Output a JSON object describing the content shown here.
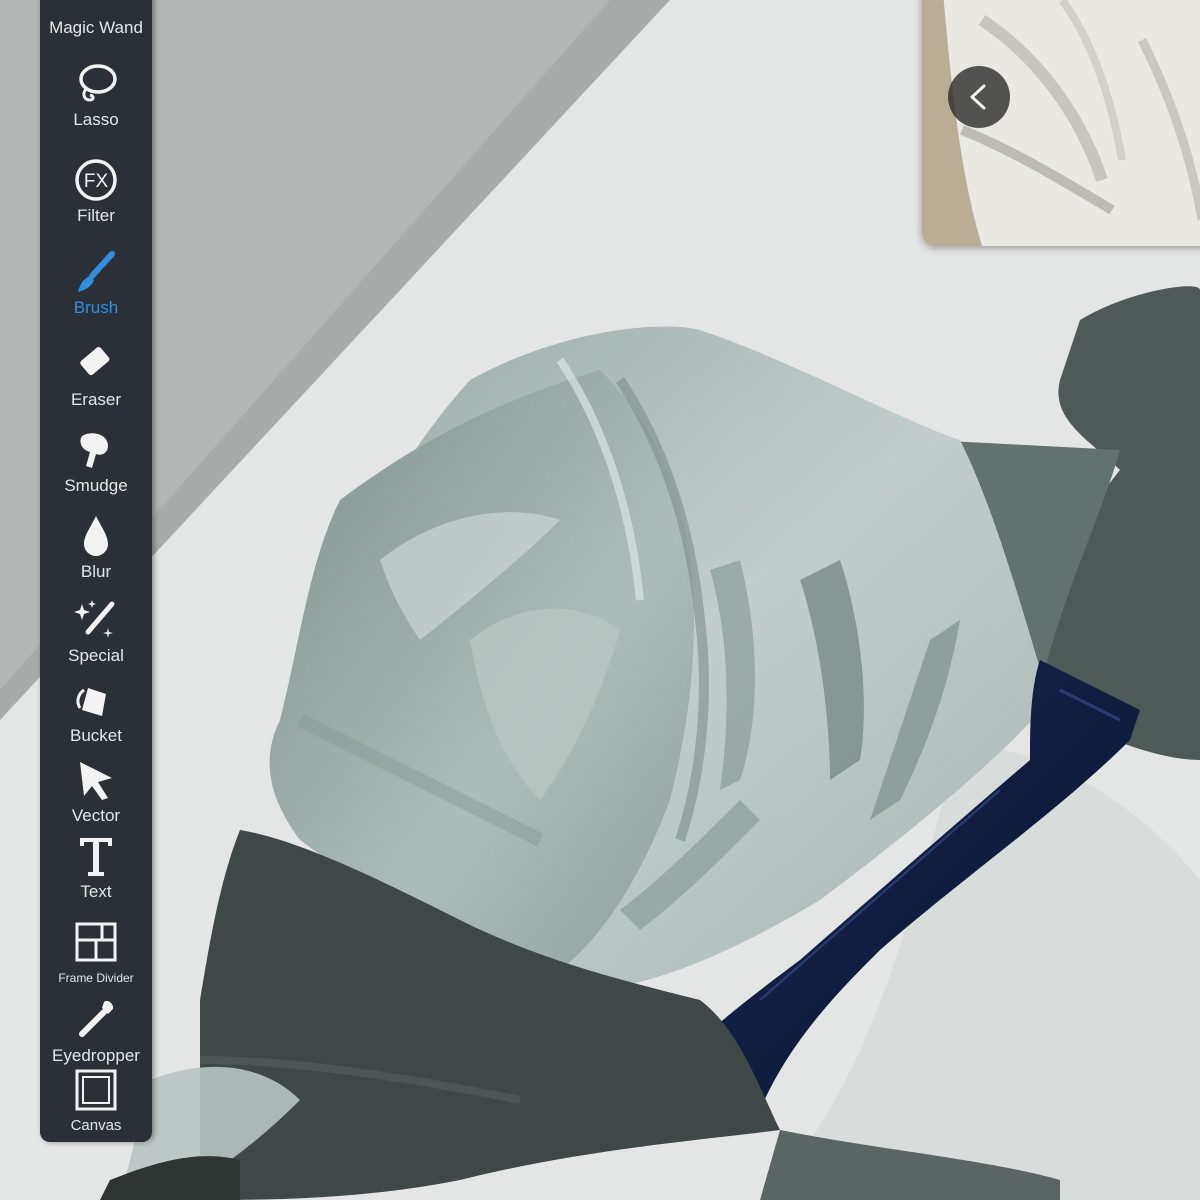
{
  "toolbar": {
    "items": [
      {
        "id": "magic-wand",
        "label": "Magic Wand",
        "icon": "magic-wand-icon",
        "active": false
      },
      {
        "id": "lasso",
        "label": "Lasso",
        "icon": "lasso-icon",
        "active": false
      },
      {
        "id": "filter",
        "label": "Filter",
        "icon": "fx-icon",
        "icon_text": "FX",
        "active": false
      },
      {
        "id": "brush",
        "label": "Brush",
        "icon": "brush-icon",
        "active": true
      },
      {
        "id": "eraser",
        "label": "Eraser",
        "icon": "eraser-icon",
        "active": false
      },
      {
        "id": "smudge",
        "label": "Smudge",
        "icon": "smudge-icon",
        "active": false
      },
      {
        "id": "blur",
        "label": "Blur",
        "icon": "blur-drop-icon",
        "active": false
      },
      {
        "id": "special",
        "label": "Special",
        "icon": "special-wand-icon",
        "active": false
      },
      {
        "id": "bucket",
        "label": "Bucket",
        "icon": "bucket-icon",
        "active": false
      },
      {
        "id": "vector",
        "label": "Vector",
        "icon": "vector-arrow-icon",
        "active": false
      },
      {
        "id": "text",
        "label": "Text",
        "icon": "text-icon",
        "active": false
      },
      {
        "id": "frame-divider",
        "label": "Frame Divider",
        "icon": "frame-divider-icon",
        "active": false
      },
      {
        "id": "eyedropper",
        "label": "Eyedropper",
        "icon": "eyedropper-icon",
        "active": false
      },
      {
        "id": "canvas",
        "label": "Canvas",
        "icon": "canvas-icon",
        "active": false
      }
    ]
  },
  "reference_panel": {
    "collapse_icon": "chevron-left-icon"
  },
  "colors": {
    "toolbar_bg": "#2b3036",
    "active_tool": "#2f8fe0",
    "shirt": "#a9b7b3",
    "tie": "#0f1b3a"
  }
}
